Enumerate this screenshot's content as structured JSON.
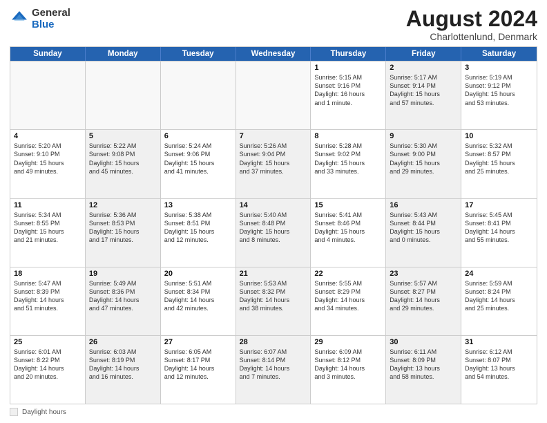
{
  "logo": {
    "general": "General",
    "blue": "Blue"
  },
  "title": "August 2024",
  "location": "Charlottenlund, Denmark",
  "days_of_week": [
    "Sunday",
    "Monday",
    "Tuesday",
    "Wednesday",
    "Thursday",
    "Friday",
    "Saturday"
  ],
  "weeks": [
    [
      {
        "day": "",
        "text": "",
        "empty": true
      },
      {
        "day": "",
        "text": "",
        "empty": true
      },
      {
        "day": "",
        "text": "",
        "empty": true
      },
      {
        "day": "",
        "text": "",
        "empty": true
      },
      {
        "day": "1",
        "text": "Sunrise: 5:15 AM\nSunset: 9:16 PM\nDaylight: 16 hours\nand 1 minute.",
        "shaded": false
      },
      {
        "day": "2",
        "text": "Sunrise: 5:17 AM\nSunset: 9:14 PM\nDaylight: 15 hours\nand 57 minutes.",
        "shaded": true
      },
      {
        "day": "3",
        "text": "Sunrise: 5:19 AM\nSunset: 9:12 PM\nDaylight: 15 hours\nand 53 minutes.",
        "shaded": false
      }
    ],
    [
      {
        "day": "4",
        "text": "Sunrise: 5:20 AM\nSunset: 9:10 PM\nDaylight: 15 hours\nand 49 minutes.",
        "shaded": false
      },
      {
        "day": "5",
        "text": "Sunrise: 5:22 AM\nSunset: 9:08 PM\nDaylight: 15 hours\nand 45 minutes.",
        "shaded": true
      },
      {
        "day": "6",
        "text": "Sunrise: 5:24 AM\nSunset: 9:06 PM\nDaylight: 15 hours\nand 41 minutes.",
        "shaded": false
      },
      {
        "day": "7",
        "text": "Sunrise: 5:26 AM\nSunset: 9:04 PM\nDaylight: 15 hours\nand 37 minutes.",
        "shaded": true
      },
      {
        "day": "8",
        "text": "Sunrise: 5:28 AM\nSunset: 9:02 PM\nDaylight: 15 hours\nand 33 minutes.",
        "shaded": false
      },
      {
        "day": "9",
        "text": "Sunrise: 5:30 AM\nSunset: 9:00 PM\nDaylight: 15 hours\nand 29 minutes.",
        "shaded": true
      },
      {
        "day": "10",
        "text": "Sunrise: 5:32 AM\nSunset: 8:57 PM\nDaylight: 15 hours\nand 25 minutes.",
        "shaded": false
      }
    ],
    [
      {
        "day": "11",
        "text": "Sunrise: 5:34 AM\nSunset: 8:55 PM\nDaylight: 15 hours\nand 21 minutes.",
        "shaded": false
      },
      {
        "day": "12",
        "text": "Sunrise: 5:36 AM\nSunset: 8:53 PM\nDaylight: 15 hours\nand 17 minutes.",
        "shaded": true
      },
      {
        "day": "13",
        "text": "Sunrise: 5:38 AM\nSunset: 8:51 PM\nDaylight: 15 hours\nand 12 minutes.",
        "shaded": false
      },
      {
        "day": "14",
        "text": "Sunrise: 5:40 AM\nSunset: 8:48 PM\nDaylight: 15 hours\nand 8 minutes.",
        "shaded": true
      },
      {
        "day": "15",
        "text": "Sunrise: 5:41 AM\nSunset: 8:46 PM\nDaylight: 15 hours\nand 4 minutes.",
        "shaded": false
      },
      {
        "day": "16",
        "text": "Sunrise: 5:43 AM\nSunset: 8:44 PM\nDaylight: 15 hours\nand 0 minutes.",
        "shaded": true
      },
      {
        "day": "17",
        "text": "Sunrise: 5:45 AM\nSunset: 8:41 PM\nDaylight: 14 hours\nand 55 minutes.",
        "shaded": false
      }
    ],
    [
      {
        "day": "18",
        "text": "Sunrise: 5:47 AM\nSunset: 8:39 PM\nDaylight: 14 hours\nand 51 minutes.",
        "shaded": false
      },
      {
        "day": "19",
        "text": "Sunrise: 5:49 AM\nSunset: 8:36 PM\nDaylight: 14 hours\nand 47 minutes.",
        "shaded": true
      },
      {
        "day": "20",
        "text": "Sunrise: 5:51 AM\nSunset: 8:34 PM\nDaylight: 14 hours\nand 42 minutes.",
        "shaded": false
      },
      {
        "day": "21",
        "text": "Sunrise: 5:53 AM\nSunset: 8:32 PM\nDaylight: 14 hours\nand 38 minutes.",
        "shaded": true
      },
      {
        "day": "22",
        "text": "Sunrise: 5:55 AM\nSunset: 8:29 PM\nDaylight: 14 hours\nand 34 minutes.",
        "shaded": false
      },
      {
        "day": "23",
        "text": "Sunrise: 5:57 AM\nSunset: 8:27 PM\nDaylight: 14 hours\nand 29 minutes.",
        "shaded": true
      },
      {
        "day": "24",
        "text": "Sunrise: 5:59 AM\nSunset: 8:24 PM\nDaylight: 14 hours\nand 25 minutes.",
        "shaded": false
      }
    ],
    [
      {
        "day": "25",
        "text": "Sunrise: 6:01 AM\nSunset: 8:22 PM\nDaylight: 14 hours\nand 20 minutes.",
        "shaded": false
      },
      {
        "day": "26",
        "text": "Sunrise: 6:03 AM\nSunset: 8:19 PM\nDaylight: 14 hours\nand 16 minutes.",
        "shaded": true
      },
      {
        "day": "27",
        "text": "Sunrise: 6:05 AM\nSunset: 8:17 PM\nDaylight: 14 hours\nand 12 minutes.",
        "shaded": false
      },
      {
        "day": "28",
        "text": "Sunrise: 6:07 AM\nSunset: 8:14 PM\nDaylight: 14 hours\nand 7 minutes.",
        "shaded": true
      },
      {
        "day": "29",
        "text": "Sunrise: 6:09 AM\nSunset: 8:12 PM\nDaylight: 14 hours\nand 3 minutes.",
        "shaded": false
      },
      {
        "day": "30",
        "text": "Sunrise: 6:11 AM\nSunset: 8:09 PM\nDaylight: 13 hours\nand 58 minutes.",
        "shaded": true
      },
      {
        "day": "31",
        "text": "Sunrise: 6:12 AM\nSunset: 8:07 PM\nDaylight: 13 hours\nand 54 minutes.",
        "shaded": false
      }
    ]
  ],
  "footer": {
    "box_label": "Daylight hours"
  }
}
